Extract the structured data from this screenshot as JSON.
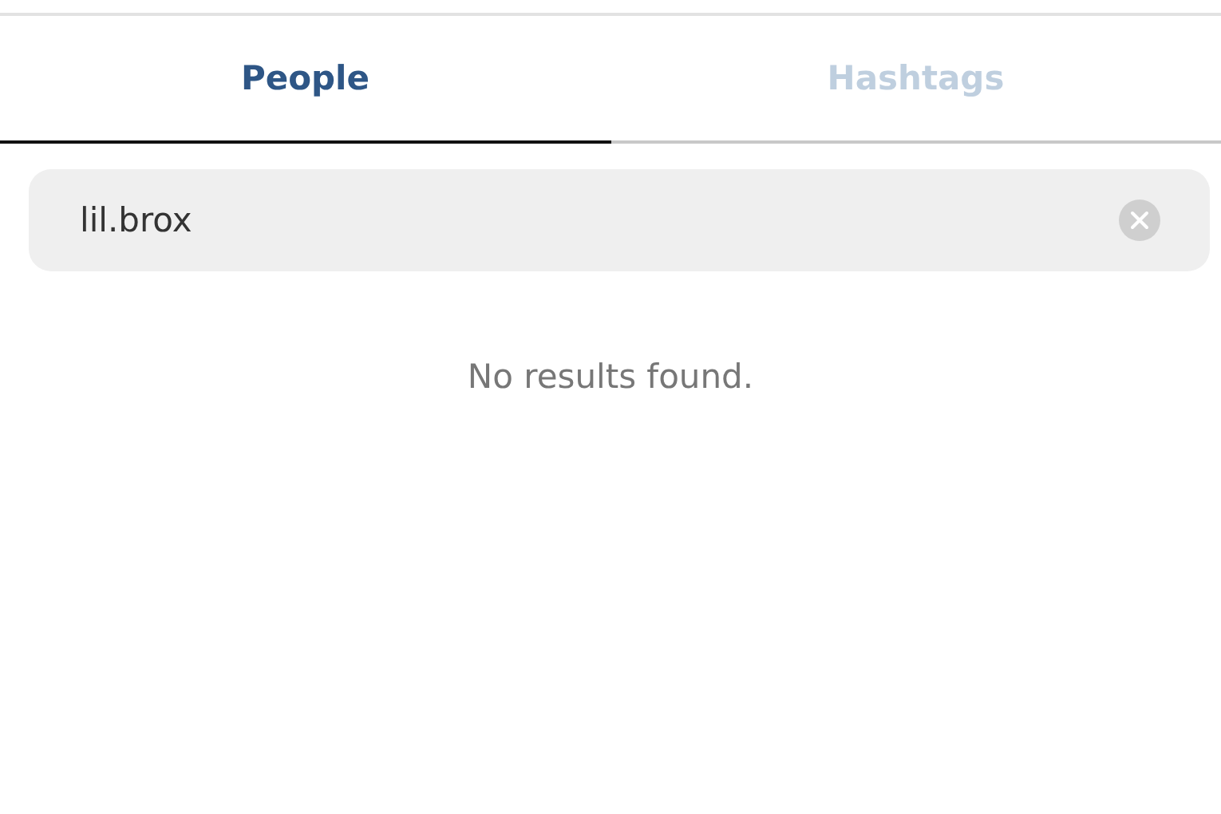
{
  "tabs": [
    {
      "label": "People",
      "selected": true
    },
    {
      "label": "Hashtags",
      "selected": false
    }
  ],
  "search": {
    "value": "lil.brox"
  },
  "message": "No results found."
}
